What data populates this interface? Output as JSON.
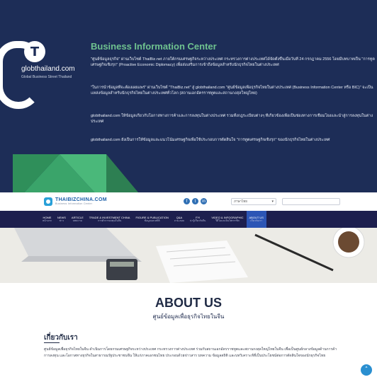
{
  "banner": {
    "logo_text": "globthailand.com",
    "logo_sub": "Global Business Street Thailand",
    "title": "Business Information Center",
    "paragraphs": [
      "\"ศูนย์ข้อมูลธุรกิจ\" ผ่านเว็บไซต์ ThaiBiz.net ภายใต้กรมเศรษฐกิจระหว่างประเทศ กระทรวงการต่างประเทศได้จัดตั้งขึ้นเมื่อวันที่ 24 กรกฎาคม 2556 โดยมีบทบาทเป็น \"การทูตเศรษฐกิจเชิงรุก\" (Proactive Economic Diplomacy) เพื่อส่งเสริมการเข้าถึงข้อมูลสำหรับนักธุรกิจไทยในต่างประเทศ",
      "\"ในการนำข้อมูลที่จะต้องเผยแพร่\" ผ่านเว็บไซต์ \"ThaiBiz.net\" สู่ globthailand.com \"ศูนย์ข้อมูลเพื่อธุรกิจไทยในต่างประเทศ (Business Information Center หรือ BIC)\" จะเป็นแหล่งข้อมูลสำหรับนักธุรกิจไทยในต่างประเทศทั่วโลก (สถานเอกอัครราชทูตและสถานกงสุลใหญ่ไทย)",
      "globthailand.com ให้ข้อมูลเกี่ยวกับโอกาสทางการค้าและการลงทุนในต่างประเทศ รวมทั้งกฎระเบียบต่างๆ ที่เกี่ยวข้องเพื่อเป็นช่องทางการเชื่อมโยงและนำสู่การลงทุนในต่างประเทศ",
      "globthailand.com ยังเป็นการให้ข้อมูลและแนวโน้มเศรษฐกิจเพื่อใช้ประกอบการตัดสินใจ \"การทูตเศรษฐกิจเชิงรุก\" ของนักธุรกิจไทยในต่างประเทศ"
    ]
  },
  "header": {
    "logo_main": "THAIBIZCHINA.COM",
    "logo_sub": "Business Information Center",
    "social": [
      "f",
      "t",
      "in"
    ],
    "lang_label": "ภาษาไทย"
  },
  "nav": [
    {
      "en": "HOME",
      "th": "หน้าแรก"
    },
    {
      "en": "NEWS",
      "th": "ข่าว"
    },
    {
      "en": "ARTICLE",
      "th": "บทความ"
    },
    {
      "en": "TRADE & INVESTMENT CHINA",
      "th": "การค้าการลงทุนในจีน"
    },
    {
      "en": "FIGURE & PUBLICATION",
      "th": "ข้อมูลและสถิติ"
    },
    {
      "en": "Q&A",
      "th": "ถาม-ตอบ"
    },
    {
      "en": "FYI",
      "th": "น่ารู้เกี่ยวกับจีน"
    },
    {
      "en": "VIDEO & INFOGRAPHIC",
      "th": "วีดีโอและอินโฟกราฟิก"
    },
    {
      "en": "ABOUT US",
      "th": "เกี่ยวกับเรา"
    }
  ],
  "about": {
    "title": "ABOUT US",
    "subtitle": "ศูนย์ข้อมูลเพื่อธุรกิจไทยในจีน",
    "section_title": "เกี่ยวกับเรา",
    "body": "ศูนย์ข้อมูลเพื่อธุรกิจไทยในจีน ดำเนินการโดยกรมเศรษฐกิจระหว่างประเทศ กระทรวงการต่างประเทศ ร่วมกับสถานเอกอัครราชทูตและสถานกงสุลใหญ่ไทยในจีน เพื่อเป็นศูนย์กลางข้อมูลด้านการค้า การลงทุน และโอกาสทางธุรกิจในสาธารณรัฐประชาชนจีน ให้แก่ภาคเอกชนไทย ประกอบด้วยข่าวสาร บทความ ข้อมูลสถิติ และบทวิเคราะห์ที่เป็นประโยชน์ต่อการตัดสินใจของนักธุรกิจไทย"
  },
  "colors": {
    "banner_bg": "#1d2d57",
    "accent_green": "#6fc28f",
    "nav_bg": "#1d1f4e",
    "nav_active": "#2c55b5"
  }
}
